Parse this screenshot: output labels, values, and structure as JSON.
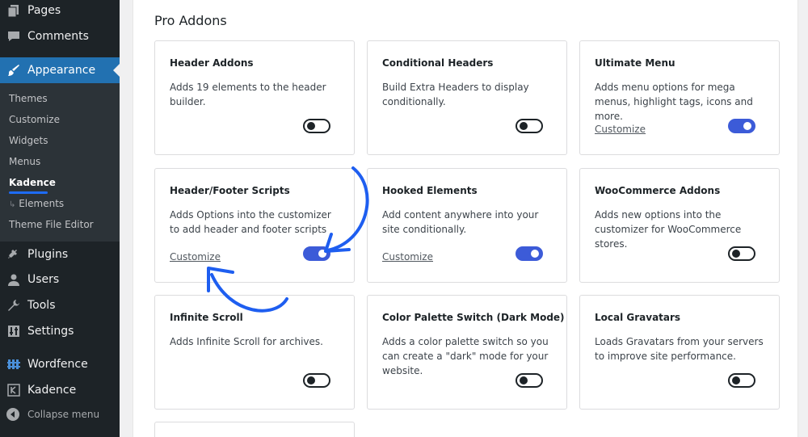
{
  "sidebar": {
    "top_items": [
      {
        "label": "Pages",
        "icon": "pages-icon"
      },
      {
        "label": "Comments",
        "icon": "comments-icon"
      }
    ],
    "active_item": {
      "label": "Appearance",
      "icon": "paintbrush-icon"
    },
    "submenu": [
      "Themes",
      "Customize",
      "Widgets",
      "Menus",
      "Kadence",
      "Elements",
      "Theme File Editor"
    ],
    "submenu_elements_prefix": "↳",
    "bottom_items": [
      {
        "label": "Plugins",
        "icon": "plug-icon"
      },
      {
        "label": "Users",
        "icon": "user-icon"
      },
      {
        "label": "Tools",
        "icon": "wrench-icon"
      },
      {
        "label": "Settings",
        "icon": "sliders-icon"
      },
      {
        "label": "Wordfence",
        "icon": "wordfence-icon"
      },
      {
        "label": "Kadence",
        "icon": "kadence-icon"
      }
    ],
    "collapse_label": "Collapse menu"
  },
  "main": {
    "section_title": "Pro Addons",
    "cards": [
      {
        "title": "Header Addons",
        "desc": "Adds 19 elements to the header builder.",
        "customize": "",
        "enabled": false
      },
      {
        "title": "Conditional Headers",
        "desc": "Build Extra Headers to display conditionally.",
        "customize": "",
        "enabled": false
      },
      {
        "title": "Ultimate Menu",
        "desc": "Adds menu options for mega menus, highlight tags, icons and more.",
        "customize": "Customize",
        "enabled": true
      },
      {
        "title": "Header/Footer Scripts",
        "desc": "Adds Options into the customizer to add header and footer scripts",
        "customize": "Customize",
        "enabled": true
      },
      {
        "title": "Hooked Elements",
        "desc": "Add content anywhere into your site conditionally.",
        "customize": "Customize",
        "enabled": true
      },
      {
        "title": "WooCommerce Addons",
        "desc": "Adds new options into the customizer for WooCommerce stores.",
        "customize": "",
        "enabled": false
      },
      {
        "title": "Infinite Scroll",
        "desc": "Adds Infinite Scroll for archives.",
        "customize": "",
        "enabled": false
      },
      {
        "title": "Color Palette Switch (Dark Mode)",
        "desc": "Adds a color palette switch so you can create a \"dark\" mode for your website.",
        "customize": "",
        "enabled": false
      },
      {
        "title": "Local Gravatars",
        "desc": "Loads Gravatars from your servers to improve site performance.",
        "customize": "",
        "enabled": false
      }
    ]
  },
  "colors": {
    "sidebar_bg": "#1d2327",
    "active_bg": "#2271b1",
    "toggle_on": "#3c5bd8",
    "annotation_arrow": "#1e5ef0"
  }
}
